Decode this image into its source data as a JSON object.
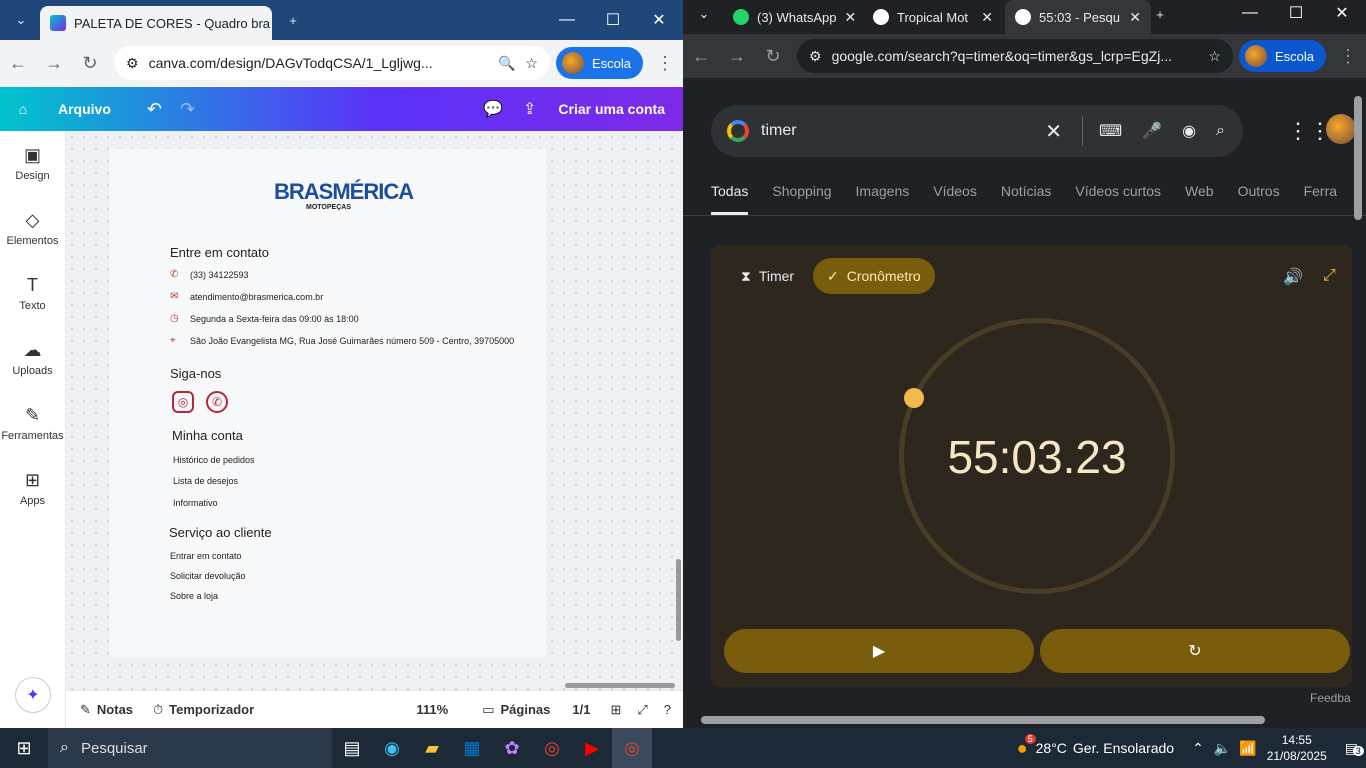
{
  "left_browser": {
    "tabs": [
      {
        "title": "PALETA DE CORES - Quadro bra"
      }
    ],
    "address": "canva.com/design/DAGvTodqCSA/1_Lgljwg...",
    "profile": "Escola"
  },
  "canva": {
    "menu": "Arquivo",
    "create_account": "Criar uma conta",
    "side": [
      {
        "label": "Design",
        "icon": "design-icon"
      },
      {
        "label": "Elementos",
        "icon": "shapes-icon"
      },
      {
        "label": "Texto",
        "icon": "text-icon"
      },
      {
        "label": "Uploads",
        "icon": "cloud-upload-icon"
      },
      {
        "label": "Ferramentas",
        "icon": "pen-icon"
      },
      {
        "label": "Apps",
        "icon": "apps-icon"
      }
    ],
    "logo_main": "BRASMÉRICA",
    "logo_sub": "MOTOPEÇAS",
    "contact_heading": "Entre em contato",
    "phone": "(33) 34122593",
    "email": "atendimento@brasmerica.com.br",
    "hours": "Segunda a Sexta-feira das 09:00 às 18:00",
    "address": "São João Evangelista MG, Rua José Guimarães número 509 - Centro, 39705000",
    "follow_heading": "Siga-nos",
    "account_heading": "Minha conta",
    "account_links": [
      "Histórico de pedidos",
      "Lista de desejos",
      "Informativo"
    ],
    "service_heading": "Serviço ao cliente",
    "service_links": [
      "Entrar em contato",
      "Solicitar devolução",
      "Sobre a loja"
    ],
    "bottom": {
      "notes": "Notas",
      "timer": "Temporizador",
      "zoom": "111%",
      "pages": "Páginas",
      "page_count": "1/1"
    }
  },
  "right_browser": {
    "tabs": [
      {
        "title": "(3) WhatsApp"
      },
      {
        "title": "Tropical Mot"
      },
      {
        "title": "55:03 - Pesqu"
      }
    ],
    "address": "google.com/search?q=timer&oq=timer&gs_lcrp=EgZj...",
    "profile": "Escola"
  },
  "google": {
    "query": "timer",
    "tabs": [
      "Todas",
      "Shopping",
      "Imagens",
      "Vídeos",
      "Notícias",
      "Vídeos curtos",
      "Web",
      "Outros",
      "Ferra"
    ],
    "timer_label": "Timer",
    "stopwatch_label": "Cronômetro",
    "time": "55:03.23",
    "feedback": "Feedba"
  },
  "taskbar": {
    "search": "Pesquisar",
    "weather_temp": "28°C",
    "weather_text": "Ger. Ensolarado",
    "weather_badge": "5",
    "time": "14:55",
    "date": "21/08/2025",
    "notif": "3"
  }
}
